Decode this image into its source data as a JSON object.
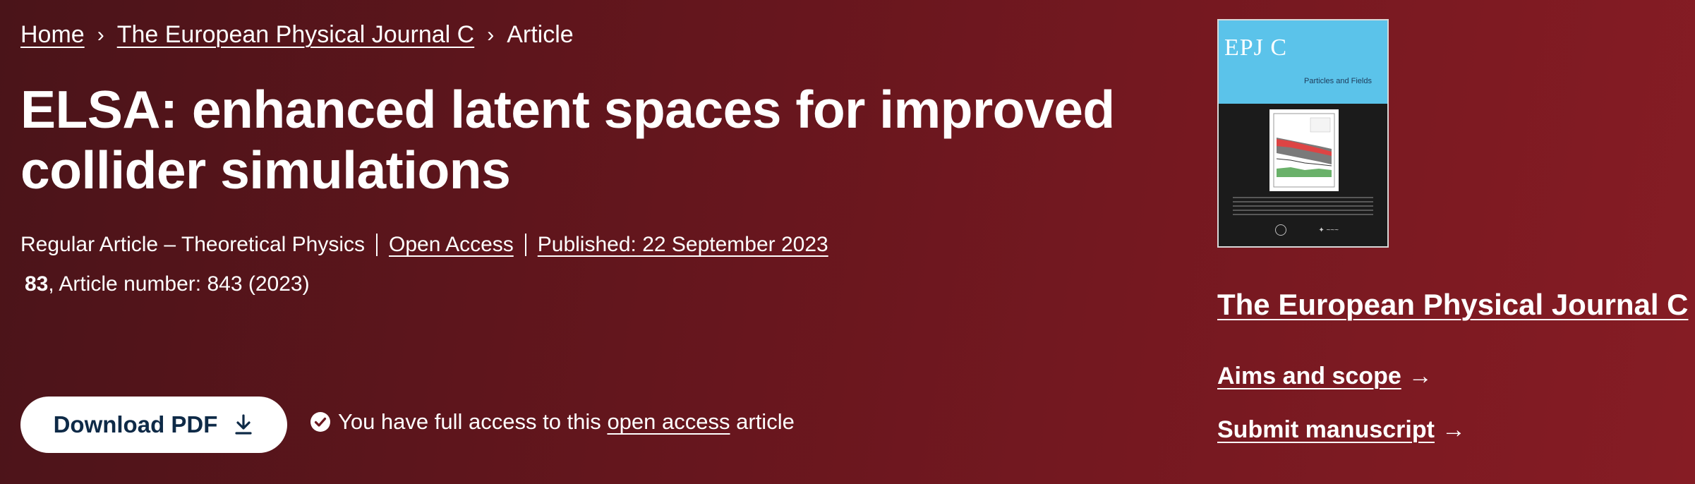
{
  "breadcrumb": {
    "items": [
      {
        "label": "Home"
      },
      {
        "label": "The European Physical Journal C"
      }
    ],
    "separator": "›",
    "current": "Article"
  },
  "article": {
    "title": "ELSA: enhanced latent spaces for improved collider simulations",
    "type": "Regular Article – Theoretical Physics",
    "open_access": "Open Access",
    "published": "Published: 22 September 2023",
    "volume": "83",
    "citation_rest": ", Article number: 843 (2023)"
  },
  "actions": {
    "download_label": "Download PDF",
    "access_prefix": "You have full access to this",
    "access_link": "open access",
    "access_suffix": "article"
  },
  "journal": {
    "cover_logo": "EPJ C",
    "cover_subtitle": "Particles and Fields",
    "title": "The European Physical Journal C",
    "links": [
      {
        "label": "Aims and scope",
        "arrow": "→"
      },
      {
        "label": "Submit manuscript",
        "arrow": "→"
      }
    ]
  },
  "colors": {
    "background_start": "#4a1419",
    "background_end": "#861c24",
    "button_text": "#0e2a47",
    "cover_accent": "#5bc3ea"
  }
}
